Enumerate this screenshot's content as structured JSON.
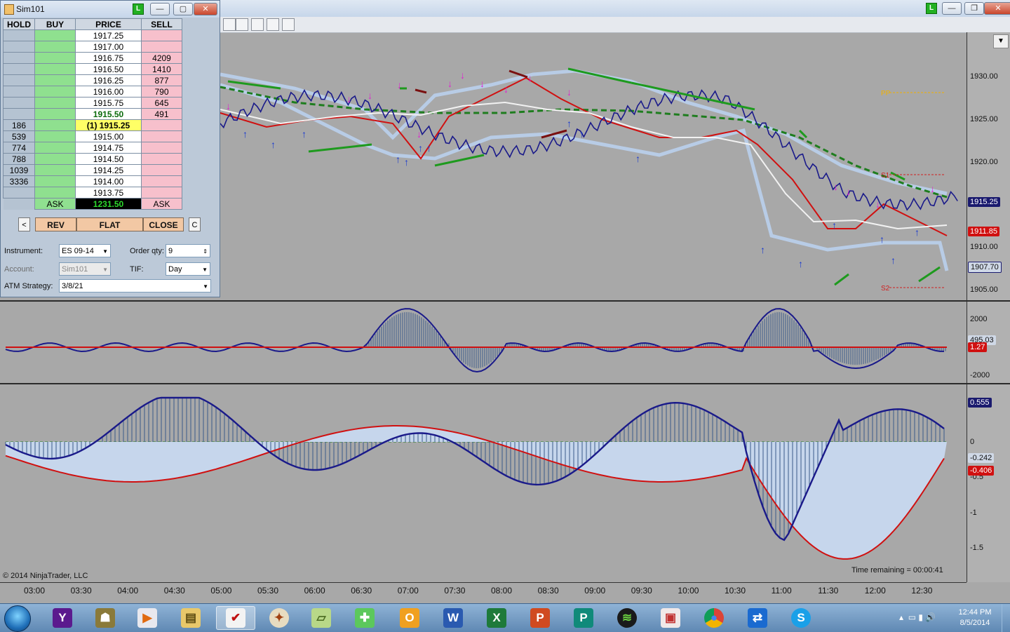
{
  "dom": {
    "title": "Sim101",
    "headers": [
      "HOLD",
      "BUY",
      "PRICE",
      "SELL"
    ],
    "ladder": [
      {
        "hold": "",
        "buy": "",
        "price": "1917.25",
        "sell": ""
      },
      {
        "hold": "",
        "buy": "",
        "price": "1917.00",
        "sell": ""
      },
      {
        "hold": "",
        "buy": "",
        "price": "1916.75",
        "sell": "4209"
      },
      {
        "hold": "",
        "buy": "",
        "price": "1916.50",
        "sell": "1410"
      },
      {
        "hold": "",
        "buy": "",
        "price": "1916.25",
        "sell": "877"
      },
      {
        "hold": "",
        "buy": "",
        "price": "1916.00",
        "sell": "790"
      },
      {
        "hold": "",
        "buy": "",
        "price": "1915.75",
        "sell": "645"
      },
      {
        "hold": "",
        "buy": "",
        "price": "1915.50",
        "sell": "491"
      },
      {
        "hold": "186",
        "buy": "",
        "price": "(1) 1915.25",
        "sell": ""
      },
      {
        "hold": "539",
        "buy": "",
        "price": "1915.00",
        "sell": ""
      },
      {
        "hold": "774",
        "buy": "",
        "price": "1914.75",
        "sell": ""
      },
      {
        "hold": "788",
        "buy": "",
        "price": "1914.50",
        "sell": ""
      },
      {
        "hold": "1039",
        "buy": "",
        "price": "1914.25",
        "sell": ""
      },
      {
        "hold": "3336",
        "buy": "",
        "price": "1914.00",
        "sell": ""
      },
      {
        "hold": "",
        "buy": "",
        "price": "1913.75",
        "sell": ""
      }
    ],
    "footer": {
      "buy": "ASK",
      "price": "1231.50",
      "sell": "ASK"
    },
    "buttons": {
      "left_arrow": "<",
      "rev": "REV",
      "flat": "FLAT",
      "close": "CLOSE",
      "c": "C"
    },
    "instrument_label": "Instrument:",
    "instrument": "ES 09-14",
    "order_qty_label": "Order qty:",
    "order_qty": "9",
    "account_label": "Account:",
    "account": "Sim101",
    "tif_label": "TIF:",
    "tif": "Day",
    "atm_label": "ATM Strategy:",
    "atm": "3/8/21",
    "badge": "L"
  },
  "chart": {
    "badge": "L",
    "copyright": "© 2014 NinjaTrader, LLC",
    "time_remaining": "Time remaining = 00:00:41",
    "price_ticks": [
      "1930.00",
      "1925.00",
      "1920.00",
      "1915.00",
      "1910.00",
      "1905.00"
    ],
    "price_flags": [
      {
        "text": "1915.25",
        "color": "#1a1a6e"
      },
      {
        "text": "1911.85",
        "color": "#d01010"
      },
      {
        "text": "1907.70",
        "color": "#cfd8e6"
      }
    ],
    "pivots": {
      "pp": "PP",
      "s1": "S1",
      "s2": "S2"
    },
    "osc1_ticks": [
      "2000",
      "-2000"
    ],
    "osc1_flags": [
      {
        "text": "495.03",
        "color": "#cfd8e6"
      },
      {
        "text": "1.27",
        "color": "#d01010"
      }
    ],
    "osc2_ticks": [
      "0",
      "-0.5",
      "-1",
      "-1.5"
    ],
    "osc2_flags": [
      {
        "text": "0.555",
        "color": "#1a1a6e"
      },
      {
        "text": "-0.242",
        "color": "#cfd8e6"
      },
      {
        "text": "-0.406",
        "color": "#d01010"
      }
    ],
    "time_labels": [
      "03:00",
      "03:30",
      "04:00",
      "04:30",
      "05:00",
      "05:30",
      "06:00",
      "06:30",
      "07:00",
      "07:30",
      "08:00",
      "08:30",
      "09:00",
      "09:30",
      "10:00",
      "10:30",
      "11:00",
      "11:30",
      "12:00",
      "12:30"
    ],
    "colors": {
      "price": "#1a1a8a",
      "ema": "#d01010",
      "band": "#b8cce6",
      "trend": "#1e7d1e"
    }
  },
  "taskbar": {
    "clock_time": "12:44 PM",
    "clock_date": "8/5/2014",
    "apps": [
      "windows-start",
      "yahoo",
      "game",
      "media-player",
      "file-explorer",
      "ninjatrader",
      "compass",
      "notes",
      "puzzle",
      "outlook",
      "word",
      "excel",
      "powerpoint",
      "publisher",
      "spotify",
      "app-red",
      "chrome",
      "teamviewer",
      "skype"
    ]
  }
}
